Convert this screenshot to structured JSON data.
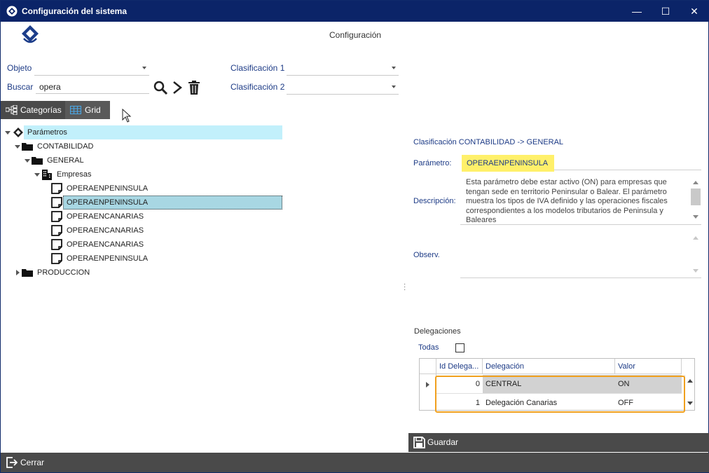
{
  "window": {
    "title": "Configuración del sistema",
    "minimize": "—",
    "maximize": "☐",
    "close": "✕"
  },
  "header": {
    "title": "Configuración"
  },
  "filters": {
    "objeto_label": "Objeto",
    "objeto_value": "",
    "buscar_label": "Buscar",
    "buscar_value": "opera",
    "clasif1_label": "Clasificación 1",
    "clasif1_value": "",
    "clasif2_label": "Clasificación 2",
    "clasif2_value": ""
  },
  "tabs": {
    "categorias": "Categorías",
    "grid": "Grid"
  },
  "tree": {
    "root": "Parámetros",
    "contabilidad": "CONTABILIDAD",
    "general": "GENERAL",
    "empresas": "Empresas",
    "items": [
      "OPERAENPENINSULA",
      "OPERAENPENINSULA",
      "OPERAENCANARIAS",
      "OPERAENCANARIAS",
      "OPERAENCANARIAS",
      "OPERAENPENINSULA"
    ],
    "produccion": "PRODUCCION"
  },
  "detail": {
    "clasificacion": "Clasificación CONTABILIDAD -> GENERAL",
    "parametro_label": "Parámetro:",
    "parametro_value": "OPERAENPENINSULA",
    "descripcion_label": "Descripción:",
    "descripcion_value": "Esta parámetro debe estar activo (ON) para empresas que tengan sede en territorio Peninsular o Balear. El parámetro muestra los tipos de IVA definido y las operaciones fiscales correspondientes a los modelos tributarios de Peninsula y Baleares",
    "observ_label": "Observ.",
    "observ_value": ""
  },
  "delegaciones": {
    "title": "Delegaciones",
    "todas_label": "Todas",
    "columns": [
      "Id Delega...",
      "Delegación",
      "Valor"
    ],
    "rows": [
      {
        "id": "0",
        "delegacion": "CENTRAL",
        "valor": "ON"
      },
      {
        "id": "1",
        "delegacion": "Delegación Canarias",
        "valor": "OFF"
      }
    ]
  },
  "actions": {
    "guardar": "Guardar",
    "cerrar": "Cerrar"
  },
  "colors": {
    "titlebar": "#0b2468",
    "accent_label": "#1d3b86",
    "highlight_yellow": "#fff06a",
    "highlight_orange": "#f0a01e",
    "tree_selected": "#a8d7e3",
    "tree_root_bg": "#c2f0fb",
    "bar_dark": "#4a4a4a"
  }
}
